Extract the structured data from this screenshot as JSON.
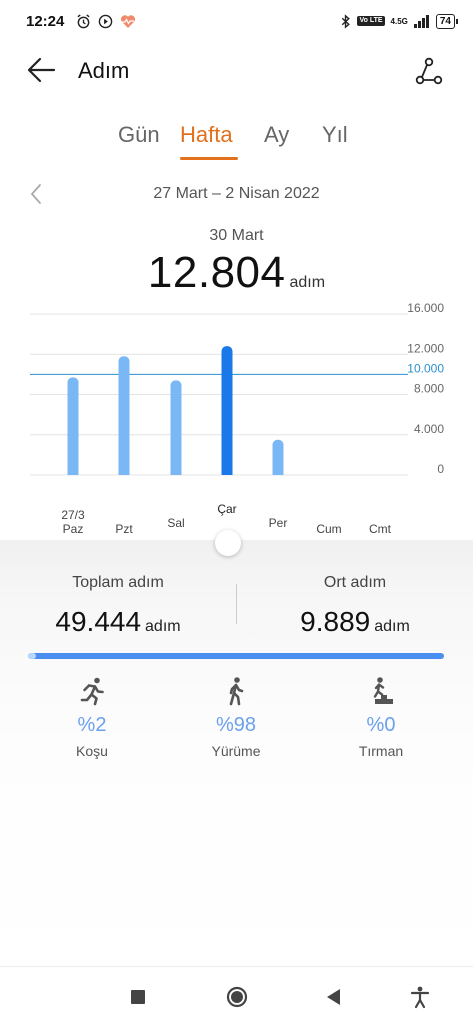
{
  "status": {
    "time": "12:24",
    "net_badge": "Vo LTE",
    "net_type": "4.5G",
    "battery": "74"
  },
  "header": {
    "title": "Adım"
  },
  "tabs": [
    {
      "label": "Gün",
      "active": false
    },
    {
      "label": "Hafta",
      "active": true
    },
    {
      "label": "Ay",
      "active": false
    },
    {
      "label": "Yıl",
      "active": false
    }
  ],
  "period": {
    "range": "27 Mart – 2 Nisan 2022"
  },
  "selected": {
    "date": "30 Mart",
    "value": "12.804",
    "unit": "adım"
  },
  "chart_data": {
    "type": "bar",
    "categories": [
      "Paz",
      "Pzt",
      "Sal",
      "Çar",
      "Per",
      "Cum",
      "Cmt"
    ],
    "date_label": "27/3",
    "values": [
      9700,
      11800,
      9400,
      12804,
      3500,
      0,
      0
    ],
    "selected_index": 3,
    "goal": 10000,
    "goal_label": "10.000",
    "ylim": [
      0,
      16000
    ],
    "y_ticks": [
      0,
      4000,
      8000,
      12000,
      16000
    ],
    "y_tick_labels": [
      "0",
      "4.000",
      "8.000",
      "12.000",
      "16.000"
    ],
    "title": "",
    "xlabel": "",
    "ylabel": "",
    "colors": {
      "bar": "#7ab8f5",
      "selected": "#1a78e8",
      "goal": "#2b8fcf"
    }
  },
  "stats": {
    "total": {
      "label": "Toplam adım",
      "value": "49.444",
      "unit": "adım"
    },
    "average": {
      "label": "Ort adım",
      "value": "9.889",
      "unit": "adım"
    }
  },
  "progress": {
    "segment_fraction": 0.02
  },
  "activities": [
    {
      "icon": "running-icon",
      "percent": "%2",
      "label": "Koşu"
    },
    {
      "icon": "walking-icon",
      "percent": "%98",
      "label": "Yürüme"
    },
    {
      "icon": "climbing-icon",
      "percent": "%0",
      "label": "Tırman"
    }
  ],
  "nav": [
    "recents-button",
    "home-button",
    "back-button",
    "accessibility-button"
  ]
}
